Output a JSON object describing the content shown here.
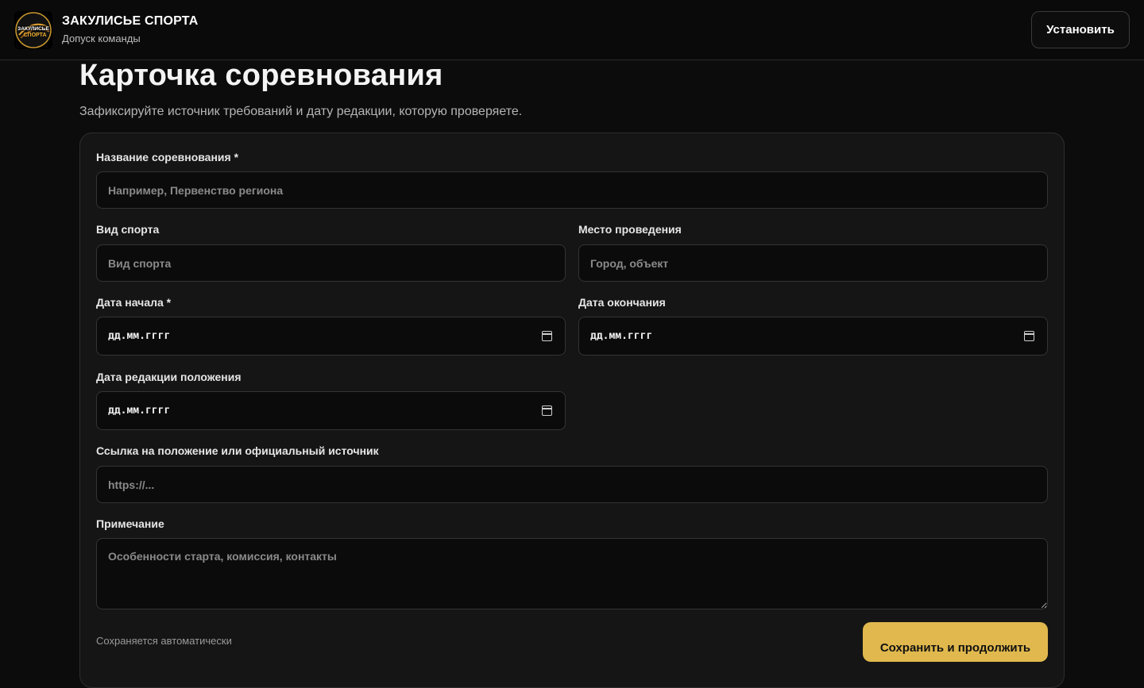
{
  "header": {
    "brand_title": "ЗАКУЛИСЬЕ СПОРТА",
    "brand_subtitle": "Допуск команды",
    "logo_text": "ЗАКУЛИСЬЕ СПОРТА",
    "install_label": "Установить"
  },
  "page": {
    "title": "Карточка соревнования",
    "subtitle": "Зафиксируйте источник требований и дату редакции, которую проверяете."
  },
  "form": {
    "competition_name": {
      "label": "Название соревнования *",
      "placeholder": "Например, Первенство региона"
    },
    "sport": {
      "label": "Вид спорта",
      "placeholder": "Вид спорта"
    },
    "venue": {
      "label": "Место проведения",
      "placeholder": "Город, объект"
    },
    "start_date": {
      "label": "Дата начала *",
      "value": "дд.мм.гггг"
    },
    "end_date": {
      "label": "Дата окончания",
      "value": "дд.мм.гггг"
    },
    "edition_date": {
      "label": "Дата редакции положения",
      "value": "дд.мм.гггг"
    },
    "source_link": {
      "label": "Ссылка на положение или официальный источник",
      "placeholder": "https://..."
    },
    "note": {
      "label": "Примечание",
      "placeholder": "Особенности старта, комиссия, контакты"
    },
    "autosave_text": "Сохраняется автоматически",
    "save_label": "Сохранить и продолжить"
  },
  "colors": {
    "background": "#0c0c0c",
    "card": "#151515",
    "accent": "#e0b84d"
  }
}
